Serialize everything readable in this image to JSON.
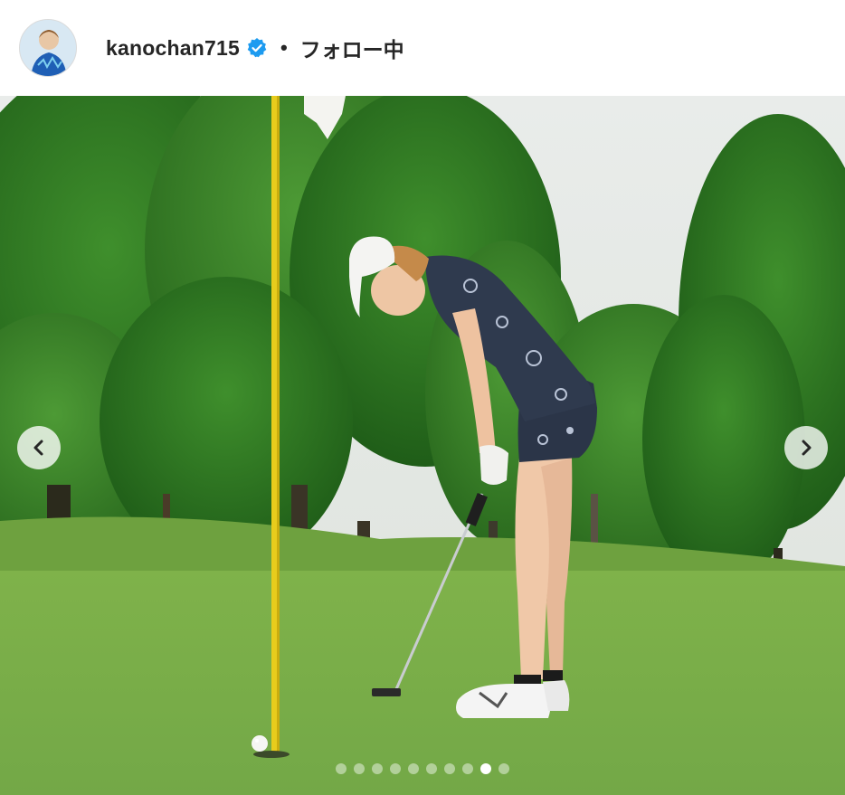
{
  "post_header": {
    "username": "kanochan715",
    "separator": "•",
    "follow_status": "フォロー中",
    "verified_color": "#1d9bf0"
  },
  "carousel": {
    "prev_icon": "chevron-left-icon",
    "next_icon": "chevron-right-icon",
    "slide_count": 10,
    "active_index": 8
  },
  "photo": {
    "scene": "golfer-putting-on-green"
  }
}
